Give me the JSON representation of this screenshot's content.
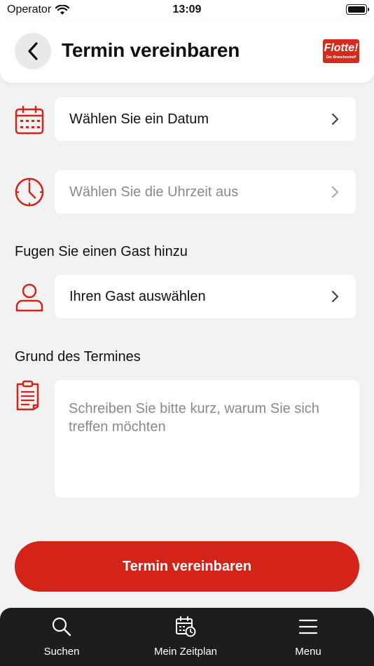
{
  "status_bar": {
    "carrier": "Operator",
    "time": "13:09"
  },
  "header": {
    "title": "Termin vereinbaren",
    "logo_text": "Flotte!",
    "logo_subtext": "Der Branchentreff"
  },
  "colors": {
    "accent": "#d42318",
    "background": "#f2f2f2",
    "tab_bar": "#1d1d1d"
  },
  "form": {
    "date": {
      "label": "Wählen Sie ein Datum",
      "icon": "calendar-icon"
    },
    "time": {
      "label": "Wählen Sie die Uhrzeit aus",
      "icon": "clock-icon"
    },
    "guest_section_label": "Fugen Sie einen Gast hinzu",
    "guest": {
      "label": "Ihren Gast auswählen",
      "icon": "person-icon"
    },
    "reason_section_label": "Grund des Termines",
    "reason": {
      "placeholder": "Schreiben Sie bitte kurz, warum Sie sich treffen möchten",
      "icon": "clipboard-icon"
    },
    "submit_label": "Termin vereinbaren"
  },
  "tab_bar": {
    "items": [
      {
        "label": "Suchen",
        "icon": "search-icon"
      },
      {
        "label": "Mein Zeitplan",
        "icon": "calendar-clock-icon"
      },
      {
        "label": "Menu",
        "icon": "menu-icon"
      }
    ]
  }
}
